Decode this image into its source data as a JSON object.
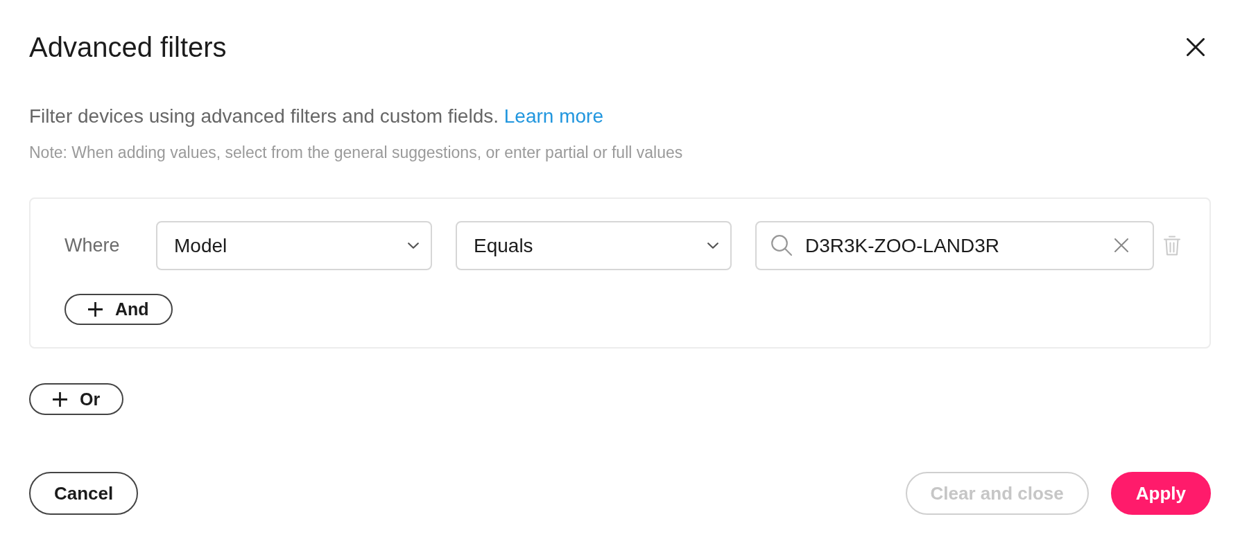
{
  "dialog": {
    "title": "Advanced filters"
  },
  "description": {
    "text": "Filter devices using advanced filters and custom fields.",
    "link": "Learn more"
  },
  "note": "Note: When adding values, select from the general suggestions, or enter partial or full values",
  "filter_group": {
    "conditions": [
      {
        "label": "Where",
        "dropdowns": [
          {
            "value": "Model"
          },
          {
            "value": "Equals"
          }
        ],
        "search_field": {
          "value": "D3R3K-ZOO-LAND3R"
        }
      }
    ],
    "add_button": {
      "label": "And"
    }
  },
  "add_group_button": {
    "label": "Or"
  },
  "footer": {
    "left": [
      {
        "label": "Cancel",
        "kind": "secondary",
        "disabled": false
      }
    ],
    "right": [
      {
        "label": "Clear and close",
        "kind": "secondary",
        "disabled": true
      },
      {
        "label": "Apply",
        "kind": "primary",
        "disabled": false
      }
    ]
  }
}
